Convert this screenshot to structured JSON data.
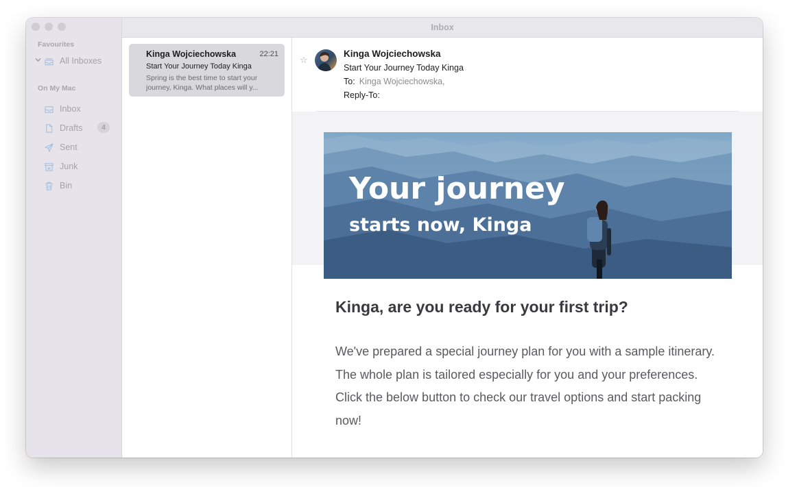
{
  "window": {
    "title": "Inbox"
  },
  "sidebar": {
    "favourites_label": "Favourites",
    "all_inboxes": "All Inboxes",
    "on_my_mac_label": "On My Mac",
    "items": [
      {
        "label": "Inbox",
        "icon": "tray-icon"
      },
      {
        "label": "Drafts",
        "icon": "document-icon",
        "count": "4"
      },
      {
        "label": "Sent",
        "icon": "paper-plane-icon"
      },
      {
        "label": "Junk",
        "icon": "junk-box-icon"
      },
      {
        "label": "Bin",
        "icon": "trash-icon"
      }
    ]
  },
  "message_list": {
    "items": [
      {
        "from": "Kinga Wojciechowska",
        "time": "22:21",
        "subject": "Start Your Journey Today Kinga",
        "preview": "Spring is the best time to start your journey, Kinga. What places will y..."
      }
    ]
  },
  "message": {
    "from": "Kinga Wojciechowska",
    "subject": "Start Your Journey Today Kinga",
    "to_label": "To:",
    "to_value": "Kinga Wojciechowska,",
    "reply_to_label": "Reply-To:",
    "banner_title": "Your journey",
    "banner_subtitle": "starts now, Kinga",
    "heading": "Kinga, are you ready for your first trip?",
    "body": "We've prepared a special journey plan for you with a sample itinerary. The whole plan is tailored especially for you and your preferences. Click the below button to check our travel options and start packing now!"
  },
  "colors": {
    "sidebar_bg": "#e6e4ea",
    "selected_row": "#d9d8dd",
    "banner_sky": "#8fb4cf",
    "banner_mountain": "#3c5d82"
  }
}
